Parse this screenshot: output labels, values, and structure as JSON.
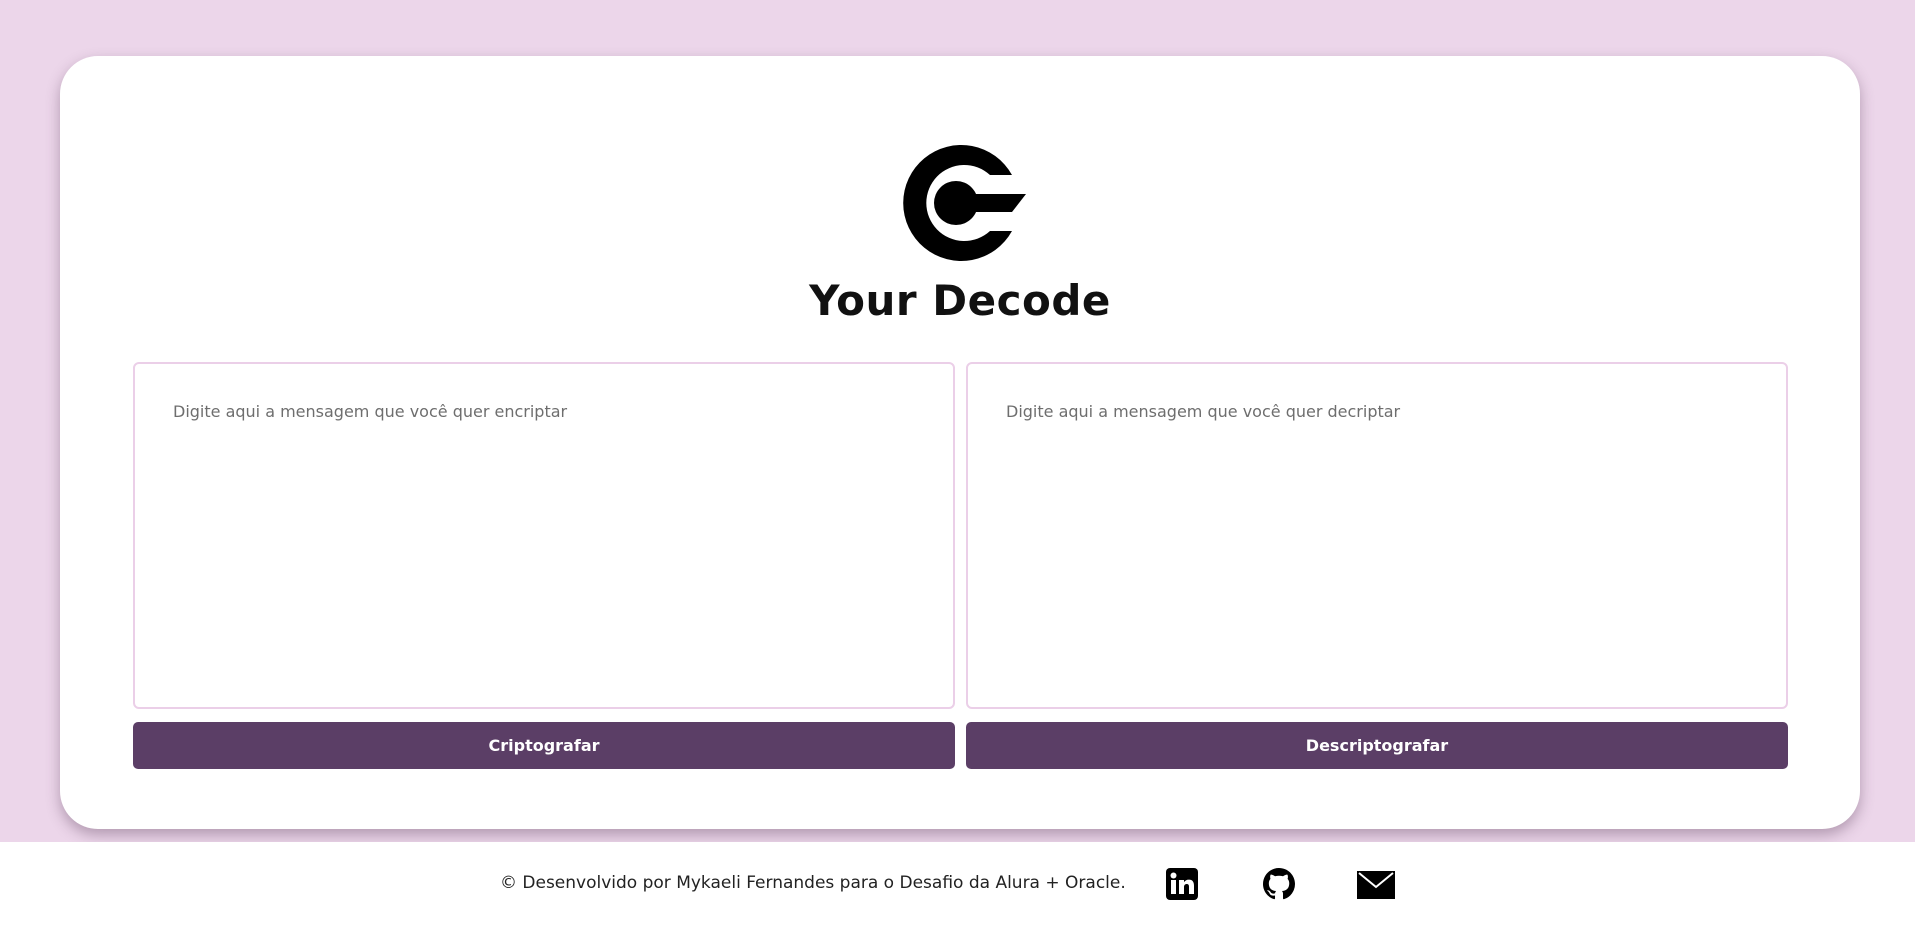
{
  "header": {
    "logo_icon": "decode-logo-icon",
    "title": "Your Decode"
  },
  "encrypt": {
    "placeholder": "Digite aqui a mensagem que você quer encriptar",
    "value": "",
    "button_label": "Criptografar"
  },
  "decrypt": {
    "placeholder": "Digite aqui a mensagem que você quer decriptar",
    "value": "",
    "button_label": "Descriptografar"
  },
  "footer": {
    "credit": "© Desenvolvido por Mykaeli Fernandes para o Desafio da Alura + Oracle.",
    "links": [
      {
        "icon": "linkedin-icon"
      },
      {
        "icon": "github-icon"
      },
      {
        "icon": "mail-icon"
      }
    ]
  },
  "colors": {
    "background": "#ecd6ea",
    "card": "#ffffff",
    "button": "#5b3e66",
    "textarea_border": "#ebcfe8"
  }
}
